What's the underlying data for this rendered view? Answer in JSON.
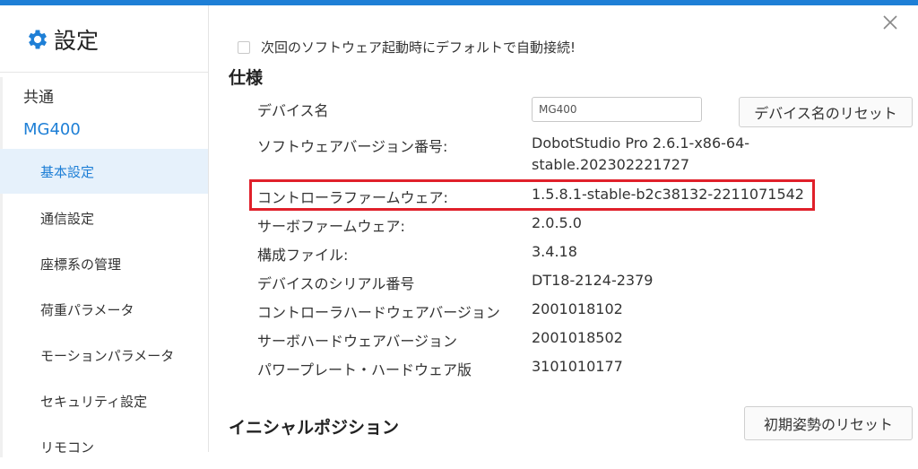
{
  "sidebar": {
    "title": "設定",
    "groups": {
      "common": "共通",
      "device": "MG400"
    },
    "items": [
      {
        "label": "基本設定",
        "active": true
      },
      {
        "label": "通信設定",
        "active": false
      },
      {
        "label": "座標系の管理",
        "active": false
      },
      {
        "label": "荷重パラメータ",
        "active": false
      },
      {
        "label": "モーションパラメータ",
        "active": false
      },
      {
        "label": "セキュリティ設定",
        "active": false
      },
      {
        "label": "リモコン",
        "active": false
      }
    ]
  },
  "main": {
    "auto_connect_label": "次回のソフトウェア起動時にデフォルトで自動接続!",
    "spec_title": "仕様",
    "device_name": {
      "label": "デバイス名",
      "value": "MG400",
      "reset_label": "デバイス名のリセット"
    },
    "software_version": {
      "label": "ソフトウェアバージョン番号:",
      "value_line1": "DobotStudio Pro 2.6.1-x86-64-",
      "value_line2": "stable.202302221727"
    },
    "controller_firmware": {
      "label": "コントローラファームウェア:",
      "value": "1.5.8.1-stable-b2c38132-2211071542"
    },
    "servo_firmware": {
      "label": "サーボファームウェア:",
      "value": "2.0.5.0"
    },
    "config_file": {
      "label": "構成ファイル:",
      "value": "3.4.18"
    },
    "serial": {
      "label": "デバイスのシリアル番号",
      "value": "DT18-2124-2379"
    },
    "controller_hw": {
      "label": "コントローラハードウェアバージョン",
      "value": "2001018102"
    },
    "servo_hw": {
      "label": "サーボハードウェアバージョン",
      "value": "2001018502"
    },
    "power_plate": {
      "label": "パワープレート・ハードウェア版",
      "value": "3101010177"
    },
    "initial_title": "イニシャルポジション",
    "initial_reset_label": "初期姿勢のリセット"
  },
  "colors": {
    "accent": "#1e7fd6",
    "highlight": "#e0202a",
    "active_bg": "#e6f1fb"
  }
}
